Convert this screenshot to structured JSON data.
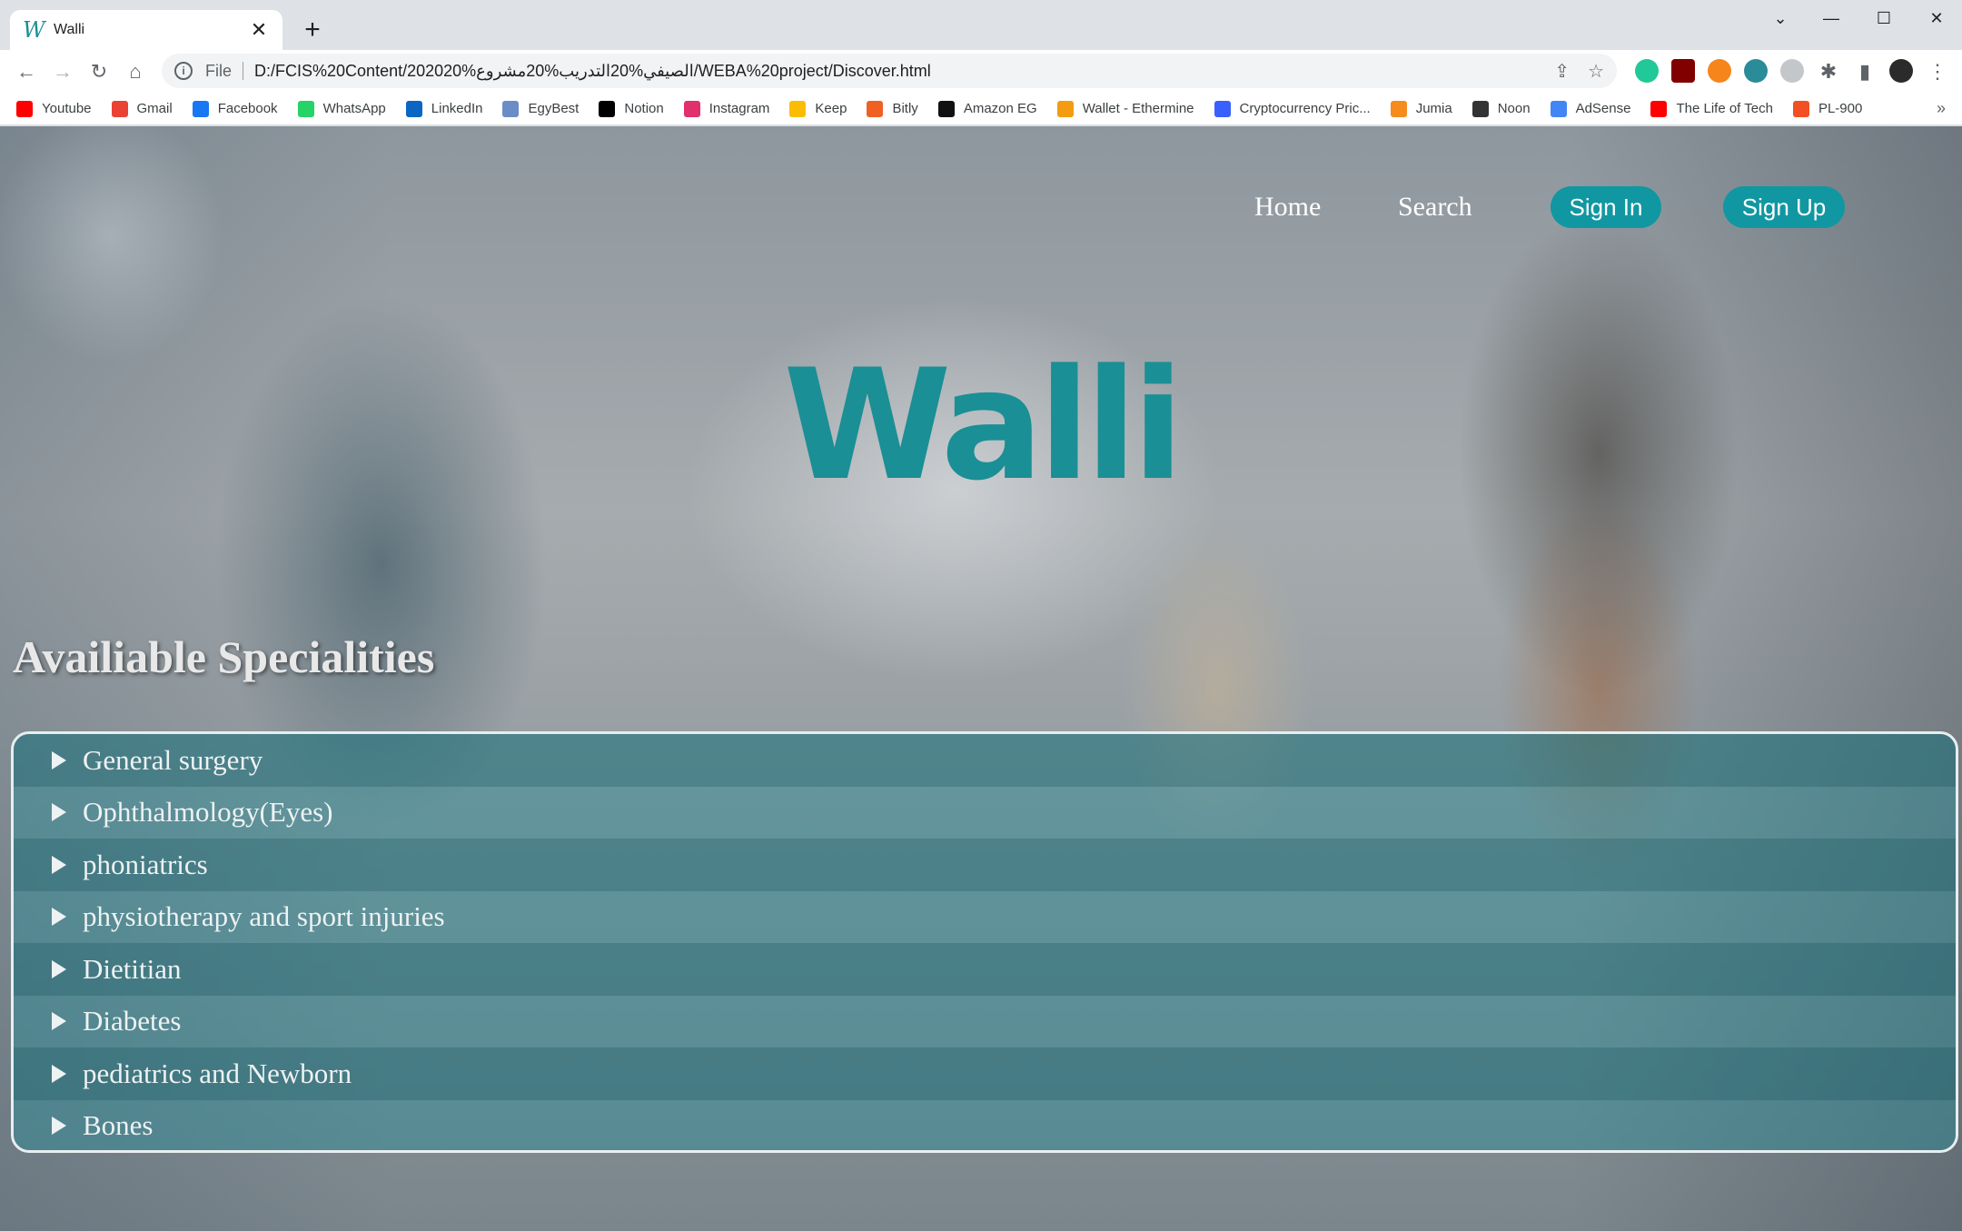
{
  "browser": {
    "tab_title": "Walli",
    "tab_favicon": "W",
    "new_tab": "+",
    "close": "✕",
    "url_scheme": "File",
    "url": "D:/FCIS%20Content/202020%الصيفي%20التدريب%20مشروع/WEBA%20project/Discover.html",
    "bookmarks": [
      {
        "label": "Youtube",
        "icon": "youtube-icon",
        "color": "#ff0000"
      },
      {
        "label": "Gmail",
        "icon": "gmail-icon",
        "color": "#ea4335"
      },
      {
        "label": "Facebook",
        "icon": "facebook-icon",
        "color": "#1877f2"
      },
      {
        "label": "WhatsApp",
        "icon": "whatsapp-icon",
        "color": "#25d366"
      },
      {
        "label": "LinkedIn",
        "icon": "linkedin-icon",
        "color": "#0a66c2"
      },
      {
        "label": "EgyBest",
        "icon": "egybest-icon",
        "color": "#6b8cc7"
      },
      {
        "label": "Notion",
        "icon": "notion-icon",
        "color": "#000000"
      },
      {
        "label": "Instagram",
        "icon": "instagram-icon",
        "color": "#e1306c"
      },
      {
        "label": "Keep",
        "icon": "keep-icon",
        "color": "#fbbc04"
      },
      {
        "label": "Bitly",
        "icon": "bitly-icon",
        "color": "#ee6123"
      },
      {
        "label": "Amazon EG",
        "icon": "amazon-icon",
        "color": "#111111"
      },
      {
        "label": "Wallet - Ethermine",
        "icon": "ethermine-icon",
        "color": "#f39c12"
      },
      {
        "label": "Cryptocurrency Pric...",
        "icon": "coinmarketcap-icon",
        "color": "#3861fb"
      },
      {
        "label": "Jumia",
        "icon": "jumia-icon",
        "color": "#f68b1e"
      },
      {
        "label": "Noon",
        "icon": "noon-icon",
        "color": "#333333"
      },
      {
        "label": "AdSense",
        "icon": "adsense-icon",
        "color": "#4285f4"
      },
      {
        "label": "The Life of Tech",
        "icon": "youtube-icon",
        "color": "#ff0000"
      },
      {
        "label": "PL-900",
        "icon": "microsoft-icon",
        "color": "#f25022"
      }
    ],
    "bookmarks_more": "»"
  },
  "nav": {
    "home": "Home",
    "search": "Search",
    "sign_in": "Sign In",
    "sign_up": "Sign Up"
  },
  "logo": "Walli",
  "section_title": "Availiable Specialities",
  "specialities": [
    "General surgery",
    "Ophthalmology(Eyes)",
    "phoniatrics",
    "physiotherapy and sport injuries",
    "Dietitian",
    "Diabetes",
    "pediatrics and Newborn",
    "Bones"
  ],
  "colors": {
    "accent": "#1197a2",
    "logo": "#1a8f95"
  }
}
